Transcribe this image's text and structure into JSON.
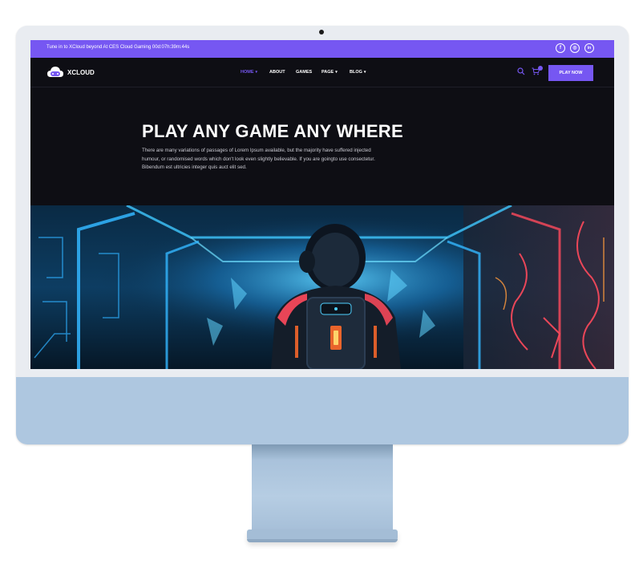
{
  "topbar": {
    "announcement": "Tune in to XCloud beyond At CES Cloud Gaming 00d:07h:39m:44s",
    "social": [
      {
        "icon": "facebook-icon",
        "glyph": "f"
      },
      {
        "icon": "instagram-icon",
        "glyph": "◎"
      },
      {
        "icon": "linkedin-icon",
        "glyph": "in"
      }
    ]
  },
  "navbar": {
    "brand": "XCLOUD",
    "items": [
      {
        "label": "HOME",
        "dropdown": true,
        "active": true
      },
      {
        "label": "ABOUT",
        "dropdown": false,
        "active": false
      },
      {
        "label": "GAMES",
        "dropdown": false,
        "active": false
      },
      {
        "label": "PAGE",
        "dropdown": true,
        "active": false
      },
      {
        "label": "BLOG",
        "dropdown": true,
        "active": false
      }
    ],
    "cta": "PLAY NOW",
    "cart_count": ""
  },
  "hero": {
    "title": "PLAY ANY GAME ANY WHERE",
    "description": "There are many variations of passages of Lorem Ipsum available, but the majority have suffered injected humour, or randomised words which don't look even slightly believable. If you are goingto use consectetur. Bibendum est ultricies integer quis auct elit sed."
  },
  "colors": {
    "accent": "#7657f2",
    "page_background": "#0e0e14",
    "monitor_chin": "#aec7e0",
    "neon_blue": "#33b6ff",
    "neon_red": "#ff4a5c"
  }
}
